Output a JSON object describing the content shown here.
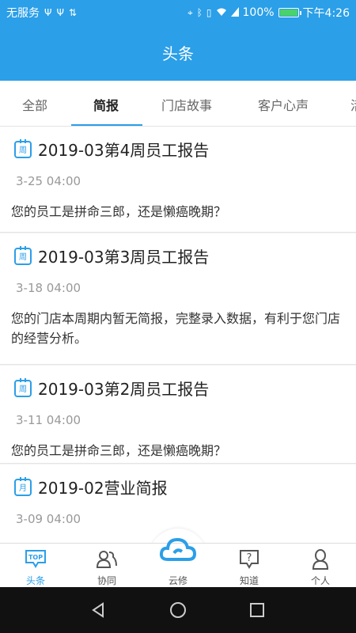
{
  "status_bar": {
    "carrier": "无服务",
    "battery_percent": "100%",
    "time": "下午4:26",
    "icons": [
      "usb-icon",
      "usb-icon",
      "data-arrows-icon",
      "location-icon",
      "bluetooth-icon",
      "vibrate-icon",
      "wifi-icon",
      "battery-charging-icon"
    ]
  },
  "header": {
    "title": "头条"
  },
  "tabs": [
    {
      "label": "全部",
      "active": false
    },
    {
      "label": "简报",
      "active": true
    },
    {
      "label": "门店故事",
      "active": false
    },
    {
      "label": "客户心声",
      "active": false
    },
    {
      "label": "活",
      "active": false
    }
  ],
  "feed": [
    {
      "icon_text": "周",
      "title": "2019-03第4周员工报告",
      "time": "3-25 04:00",
      "text": "您的员工是拼命三郎，还是懒癌晚期？"
    },
    {
      "icon_text": "周",
      "title": "2019-03第3周员工报告",
      "time": "3-18 04:00",
      "text": "您的门店本周期内暂无简报，完整录入数据，有利于您门店的经营分析。"
    },
    {
      "icon_text": "周",
      "title": "2019-03第2周员工报告",
      "time": "3-11 04:00",
      "text": "您的员工是拼命三郎，还是懒癌晚期？"
    },
    {
      "icon_text": "月",
      "title": "2019-02营业简报",
      "time": "3-09 04:00",
      "text": ""
    }
  ],
  "bottom_nav": [
    {
      "label": "头条",
      "icon": "top-badge-icon",
      "active": true,
      "badge_text": "TOP"
    },
    {
      "label": "协同",
      "icon": "people-icon",
      "active": false
    },
    {
      "label": "云修",
      "icon": "cloud-icon",
      "active": false
    },
    {
      "label": "知道",
      "icon": "question-icon",
      "active": false
    },
    {
      "label": "个人",
      "icon": "person-icon",
      "active": false
    }
  ],
  "colors": {
    "primary": "#2b9fe8",
    "text": "#222222",
    "muted": "#999999"
  }
}
